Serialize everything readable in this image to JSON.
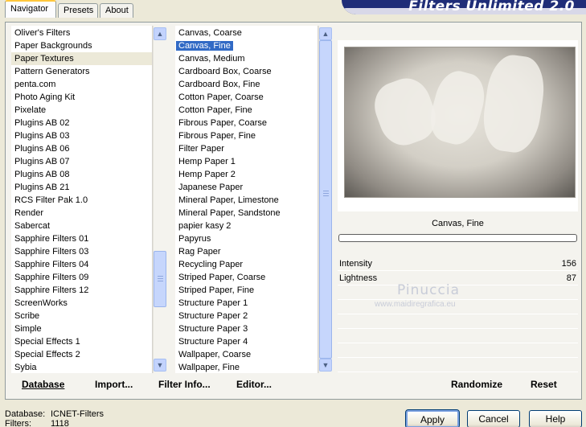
{
  "app_title": "Filters Unlimited 2.0",
  "tabs": [
    "Navigator",
    "Presets",
    "About"
  ],
  "categories": [
    "Oliver's Filters",
    "Paper Backgrounds",
    "Paper Textures",
    "Pattern Generators",
    "penta.com",
    "Photo Aging Kit",
    "Pixelate",
    "Plugins AB 02",
    "Plugins AB 03",
    "Plugins AB 06",
    "Plugins AB 07",
    "Plugins AB 08",
    "Plugins AB 21",
    "RCS Filter Pak 1.0",
    "Render",
    "Sabercat",
    "Sapphire Filters 01",
    "Sapphire Filters 03",
    "Sapphire Filters 04",
    "Sapphire Filters 09",
    "Sapphire Filters 12",
    "ScreenWorks",
    "Scribe",
    "Simple",
    "Special Effects 1",
    "Special Effects 2",
    "Sybia"
  ],
  "selected_category": "Paper Textures",
  "filters": [
    "Canvas, Coarse",
    "Canvas, Fine",
    "Canvas, Medium",
    "Cardboard Box, Coarse",
    "Cardboard Box, Fine",
    "Cotton Paper, Coarse",
    "Cotton Paper, Fine",
    "Fibrous Paper, Coarse",
    "Fibrous Paper, Fine",
    "Filter Paper",
    "Hemp Paper 1",
    "Hemp Paper 2",
    "Japanese Paper",
    "Mineral Paper, Limestone",
    "Mineral Paper, Sandstone",
    "papier kasy 2",
    "Papyrus",
    "Rag Paper",
    "Recycling Paper",
    "Striped Paper, Coarse",
    "Striped Paper, Fine",
    "Structure Paper 1",
    "Structure Paper 2",
    "Structure Paper 3",
    "Structure Paper 4",
    "Wallpaper, Coarse",
    "Wallpaper, Fine"
  ],
  "selected_filter": "Canvas, Fine",
  "preview_filter_name": "Canvas, Fine",
  "params": [
    {
      "label": "Intensity",
      "value": "156"
    },
    {
      "label": "Lightness",
      "value": "87"
    }
  ],
  "watermark": {
    "line1": "Pinuccia",
    "line2": "www.maidiregrafica.eu"
  },
  "bottom_links": {
    "database": "Database",
    "import": "Import...",
    "filter_info": "Filter Info...",
    "editor": "Editor...",
    "randomize": "Randomize",
    "reset": "Reset"
  },
  "status": {
    "database_label": "Database:",
    "database_value": "ICNET-Filters",
    "filters_label": "Filters:",
    "filters_value": "1118"
  },
  "buttons": {
    "apply": "Apply",
    "cancel": "Cancel",
    "help": "Help"
  }
}
